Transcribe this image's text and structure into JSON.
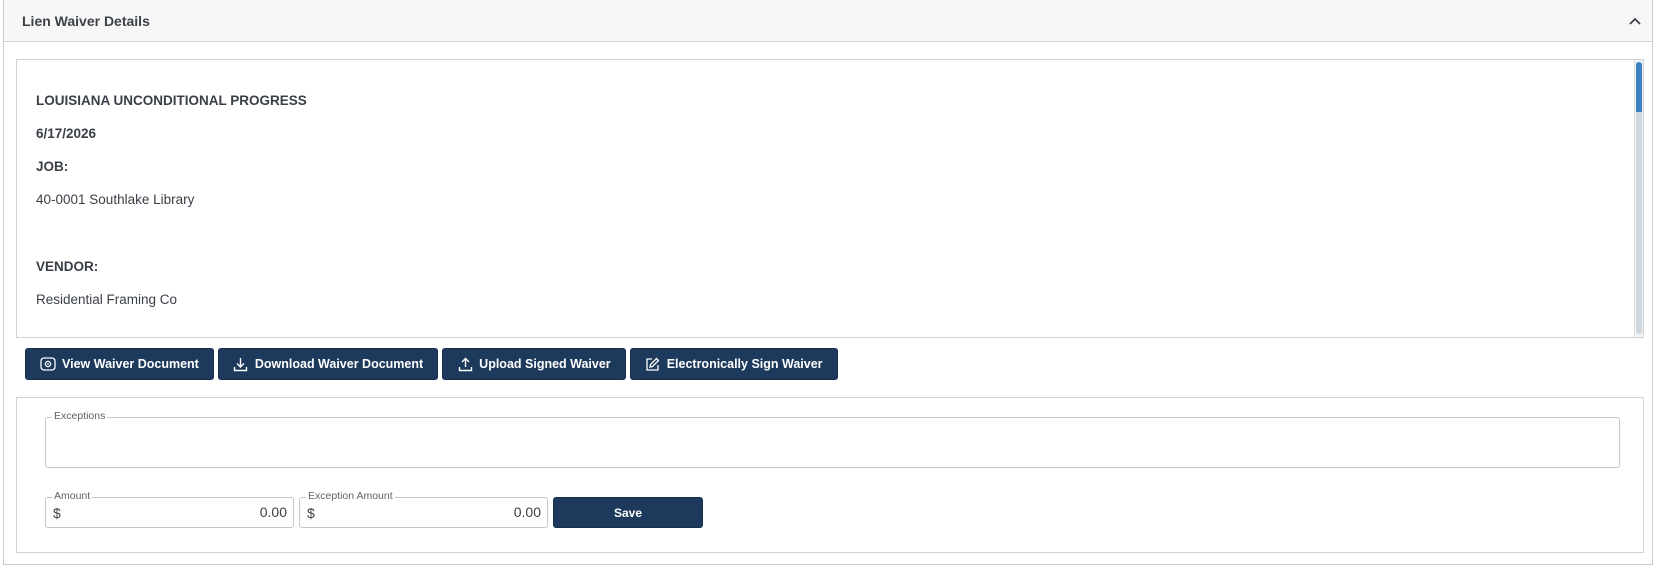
{
  "panel": {
    "title": "Lien Waiver Details"
  },
  "document": {
    "lines": [
      {
        "text": "LOUISIANA UNCONDITIONAL PROGRESS",
        "bold": true
      },
      {
        "text": "6/17/2026",
        "bold": true
      },
      {
        "text": "JOB:",
        "bold": true
      },
      {
        "text": "40-0001 Southlake Library",
        "bold": false
      },
      {
        "text": "VENDOR:",
        "bold": true
      },
      {
        "text": "Residential Framing Co",
        "bold": false
      }
    ]
  },
  "actions": {
    "view": "View Waiver Document",
    "download": "Download Waiver Document",
    "upload": "Upload Signed Waiver",
    "sign": "Electronically Sign Waiver"
  },
  "form": {
    "exceptions_label": "Exceptions",
    "exceptions_value": "",
    "amount_label": "Amount",
    "amount_currency": "$",
    "amount_value": "0.00",
    "exception_amount_label": "Exception Amount",
    "exception_amount_currency": "$",
    "exception_amount_value": "0.00",
    "save_label": "Save"
  },
  "icons": {
    "collapse": "chevron-up-icon",
    "view": "eye-icon",
    "download": "download-icon",
    "upload": "upload-icon",
    "sign": "edit-icon"
  },
  "colors": {
    "primary_button": "#1d3a5c",
    "scroll_accent": "#3b82c4"
  }
}
